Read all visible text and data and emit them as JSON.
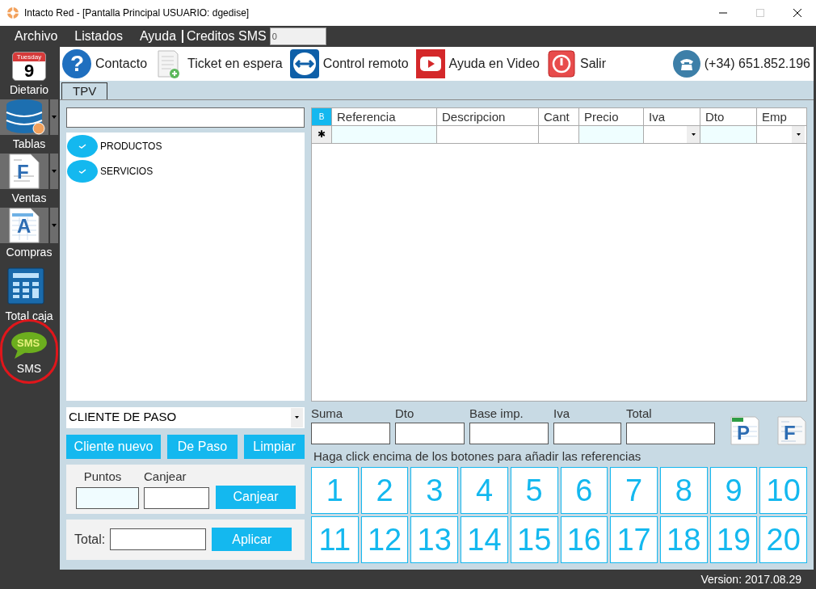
{
  "window": {
    "title": "Intacto Red - [Pantalla Principal USUARIO: dgedise]"
  },
  "menu": {
    "items": [
      "Archivo",
      "Listados",
      "Ayuda"
    ],
    "credits_label": "Creditos SMS",
    "credits_value": "0"
  },
  "sidebar": {
    "calendar": {
      "day_name": "Tuesday",
      "day": "9"
    },
    "items": [
      {
        "kind": "calendar",
        "label": "Dietario",
        "dropdown": false,
        "highlighted": false
      },
      {
        "kind": "database",
        "label": "Tablas",
        "dropdown": true,
        "highlighted": false
      },
      {
        "kind": "invoice",
        "label": "Ventas",
        "dropdown": true,
        "highlighted": false,
        "icon_text": "F"
      },
      {
        "kind": "purchase",
        "label": "Compras",
        "dropdown": true,
        "highlighted": false,
        "icon_text": "A"
      },
      {
        "kind": "calculator",
        "label": "Total caja",
        "dropdown": false,
        "highlighted": false
      },
      {
        "kind": "sms",
        "label": "SMS",
        "dropdown": false,
        "highlighted": true,
        "icon_text": "SMS"
      }
    ]
  },
  "toolbar": [
    {
      "kind": "help",
      "label": "Contacto",
      "icon_text": "?"
    },
    {
      "kind": "ticket",
      "label": "Ticket en espera"
    },
    {
      "kind": "remote",
      "label": "Control remoto"
    },
    {
      "kind": "video",
      "label": "Ayuda en Video"
    },
    {
      "kind": "exit",
      "label": "Salir"
    }
  ],
  "phone": "(+34) 651.852.196",
  "tabs": [
    {
      "label": "TPV",
      "selected": true
    }
  ],
  "tree": [
    {
      "label": "PRODUCTOS"
    },
    {
      "label": "SERVICIOS"
    }
  ],
  "grid": {
    "corner": "B",
    "new_row_marker": "✱",
    "columns": [
      {
        "label": "Referencia",
        "kind": "tinted"
      },
      {
        "label": "Descripcion",
        "kind": "plain"
      },
      {
        "label": "Cant",
        "kind": "plain"
      },
      {
        "label": "Precio",
        "kind": "tinted"
      },
      {
        "label": "Iva",
        "kind": "combo"
      },
      {
        "label": "Dto",
        "kind": "tinted"
      },
      {
        "label": "Emp",
        "kind": "combo"
      }
    ]
  },
  "client": {
    "value": "CLIENTE DE PASO",
    "buttons": [
      "Cliente nuevo",
      "De Paso",
      "Limpiar"
    ]
  },
  "points": {
    "puntos_label": "Puntos",
    "canjear_label": "Canjear",
    "button": "Canjear"
  },
  "total_apply": {
    "label": "Total:",
    "button": "Aplicar"
  },
  "totals": [
    "Suma",
    "Dto",
    "Base imp.",
    "Iva",
    "Total"
  ],
  "doc_buttons": [
    {
      "kind": "p",
      "letter": "P"
    },
    {
      "kind": "f",
      "letter": "F"
    }
  ],
  "hint": "Haga click encima de los botones para añadir las referencias",
  "keys": [
    "1",
    "2",
    "3",
    "4",
    "5",
    "6",
    "7",
    "8",
    "9",
    "10",
    "11",
    "12",
    "13",
    "14",
    "15",
    "16",
    "17",
    "18",
    "19",
    "20"
  ],
  "status": "Version: 2017.08.29"
}
